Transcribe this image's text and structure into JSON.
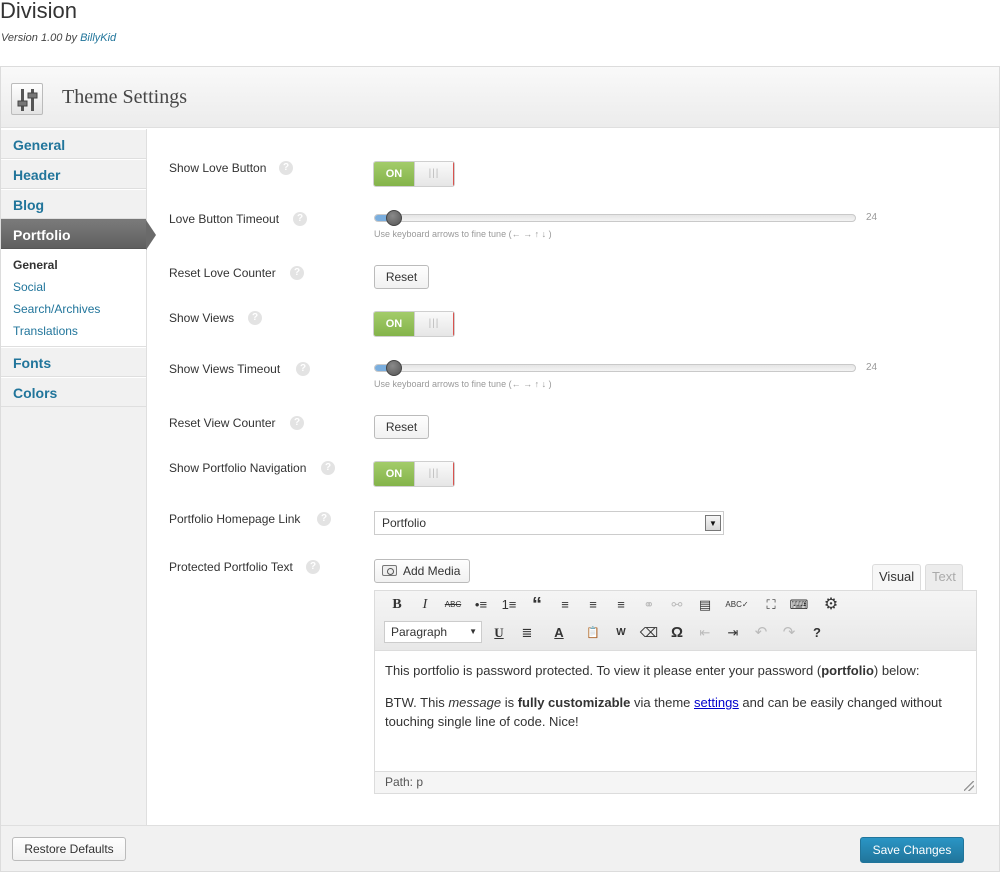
{
  "theme": {
    "title": "Division",
    "version_prefix": "Version 1.00 by ",
    "author": "BillyKid"
  },
  "panel": {
    "title": "Theme Settings"
  },
  "sidebar": {
    "items": [
      "General",
      "Header",
      "Blog",
      "Portfolio",
      "Fonts",
      "Colors"
    ],
    "active": "Portfolio",
    "subitems": [
      "General",
      "Social",
      "Search/Archives",
      "Translations"
    ],
    "current_subitem": "General"
  },
  "settings": {
    "show_love_button": {
      "label": "Show Love Button",
      "toggle": "ON"
    },
    "love_button_timeout": {
      "label": "Love Button Timeout",
      "value": "24",
      "fraction": 0.04,
      "hint": "Use keyboard arrows to fine tune (← → ↑ ↓ )"
    },
    "reset_love_counter": {
      "label": "Reset Love Counter",
      "button": "Reset"
    },
    "show_views": {
      "label": "Show Views",
      "toggle": "ON"
    },
    "show_views_timeout": {
      "label": "Show Views Timeout",
      "value": "24",
      "fraction": 0.04,
      "hint": "Use keyboard arrows to fine tune (← → ↑ ↓ )"
    },
    "reset_view_counter": {
      "label": "Reset View Counter",
      "button": "Reset"
    },
    "show_portfolio_navigation": {
      "label": "Show Portfolio Navigation",
      "toggle": "ON"
    },
    "portfolio_homepage_link": {
      "label": "Portfolio Homepage Link",
      "selected": "Portfolio"
    },
    "protected_portfolio_text": {
      "label": "Protected Portfolio Text"
    }
  },
  "help_glyph": "?",
  "toggle_knob_glyph": "|||",
  "editor": {
    "add_media": "Add Media",
    "tabs": {
      "visual": "Visual",
      "text": "Text"
    },
    "format_select": "Paragraph",
    "toolbar_row1": [
      "B",
      "I",
      "ABC",
      "•≡",
      "1≡",
      "“",
      "≡",
      "≡",
      "≡",
      "⚭",
      "⚯",
      "▤",
      "ABC✓",
      "⛶",
      "⌨",
      "⚙"
    ],
    "toolbar_row2": [
      "U",
      "≣",
      "A",
      "📋",
      "W",
      "⌫",
      "Ω",
      "⇤",
      "⇥",
      "↶",
      "↷",
      "?"
    ],
    "para1_before": "This portfolio is password protected. To view it please enter your password (",
    "para1_bold": "portfolio",
    "para1_after": ") below:",
    "para2_a": "BTW. This ",
    "para2_em": "message",
    "para2_b": " is ",
    "para2_strong": "fully customizable",
    "para2_c": " via theme ",
    "para2_link": "settings",
    "para2_d": " and can be easily changed without touching single line of code. Nice!",
    "path": "Path: p"
  },
  "footer": {
    "restore": "Restore Defaults",
    "save": "Save Changes"
  },
  "colors": {
    "accent": "#21759b",
    "toggle_on": "#8ebd55",
    "slider_fill": "#7aaede"
  }
}
